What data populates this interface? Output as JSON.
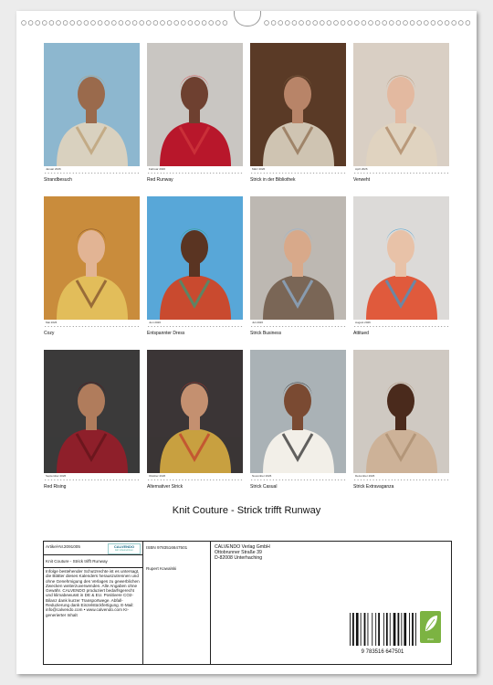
{
  "calendar": {
    "title": "Knit Couture - Strick trifft Runway",
    "months": [
      {
        "month_label": "Januar 2026",
        "caption": "Strandbesuch",
        "colors": {
          "bg": "#8db7cf",
          "main": "#d9d1bf",
          "accent": "#b99b6d",
          "skin": "#9a6a4c"
        }
      },
      {
        "month_label": "Februar 2026",
        "caption": "Red Runway",
        "colors": {
          "bg": "#c9c6c2",
          "main": "#b8172b",
          "accent": "#d23a3e",
          "skin": "#6e4030"
        }
      },
      {
        "month_label": "März 2026",
        "caption": "Strick in der Bibliothek",
        "colors": {
          "bg": "#5a3a26",
          "main": "#cfc4b2",
          "accent": "#8a6a4a",
          "skin": "#b88468"
        }
      },
      {
        "month_label": "April 2026",
        "caption": "Verweht",
        "colors": {
          "bg": "#d9cfc4",
          "main": "#e0d3c0",
          "accent": "#a8805c",
          "skin": "#e3b9a0"
        }
      },
      {
        "month_label": "Mai 2026",
        "caption": "Cozy",
        "colors": {
          "bg": "#c98c3c",
          "main": "#e2bd5a",
          "accent": "#7a4a2a",
          "skin": "#e2b494"
        }
      },
      {
        "month_label": "Juni 2026",
        "caption": "Entspannter Dress",
        "colors": {
          "bg": "#58a7d8",
          "main": "#c94a2f",
          "accent": "#2f9d7a",
          "skin": "#5a3422"
        }
      },
      {
        "month_label": "Juli 2026",
        "caption": "Strick Business",
        "colors": {
          "bg": "#bdb8b2",
          "main": "#7a6656",
          "accent": "#8fb2d6",
          "skin": "#d8a98a"
        }
      },
      {
        "month_label": "August 2026",
        "caption": "Attitued",
        "colors": {
          "bg": "#dcdad8",
          "main": "#e05a3c",
          "accent": "#3a9ad0",
          "skin": "#e8c2a8"
        }
      },
      {
        "month_label": "September 2026",
        "caption": "Red Rising",
        "colors": {
          "bg": "#3b3a3a",
          "main": "#8e1f2a",
          "accent": "#5e1218",
          "skin": "#b07c5c"
        }
      },
      {
        "month_label": "Oktober 2026",
        "caption": "Alternativer Strick",
        "colors": {
          "bg": "#3b3536",
          "main": "#c8a040",
          "accent": "#c0392b",
          "skin": "#c49070"
        }
      },
      {
        "month_label": "November 2026",
        "caption": "Strick Casual",
        "colors": {
          "bg": "#aab2b6",
          "main": "#f2efe8",
          "accent": "#222222",
          "skin": "#7a4a32"
        }
      },
      {
        "month_label": "Dezember 2026",
        "caption": "Strick Extravaganza",
        "colors": {
          "bg": "#cfc9c2",
          "main": "#cdb298",
          "accent": "#a88a6c",
          "skin": "#4a2a1c"
        }
      }
    ]
  },
  "product_info": {
    "article_label": "Artikel-Nr.:",
    "article_number": "2091005",
    "logo_text": "CALVENDO",
    "logo_sub": "Ein Unternehmen",
    "product_title": "Knit Couture - Strick trifft Runway",
    "description": "Infolge bestehender Schutzrechte ist es untersagt, die Blätter dieses Kalenders herauszutrennen und ohne Genehmigung des Verlages zu gewerblichen Zwecken weiterzuverwenden. Alle Angaben ohne Gewähr. CALVENDO produziert bedarfsgerecht und klimabewusst in DE & EU. Positivere CO2-Bilanz dank kurzer Transportwege. Abfall-Reduzierung dank Einzelstückfertigung. E-Mail: info@calvendo.com • www.calvendo.com KI-generierter Inhalt",
    "isbn": "ISBN 9783516647501",
    "author": "Rupert Kowalski",
    "publisher_lines": [
      "CALVENDO Verlag GmbH",
      "Ottobrunner Straße 39",
      "D-82008 Unterhaching"
    ],
    "barcode_digits": "9 783516 647501",
    "eco_label": "eco",
    "eco_color": "#7cb342"
  }
}
